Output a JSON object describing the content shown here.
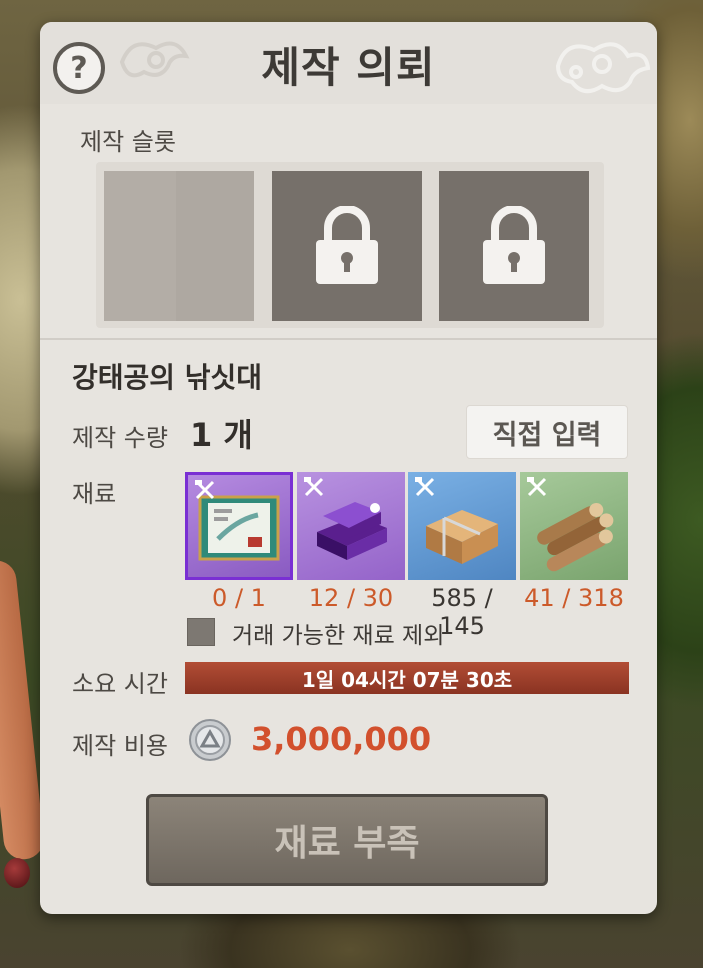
{
  "panel": {
    "title": "제작 의뢰",
    "help_icon_glyph": "?"
  },
  "slots": {
    "label": "제작 슬롯",
    "items": [
      {
        "state": "open"
      },
      {
        "state": "locked",
        "icon": "lock-icon"
      },
      {
        "state": "locked",
        "icon": "lock-icon"
      }
    ]
  },
  "item": {
    "name": "강태공의 낚싯대"
  },
  "quantity": {
    "label": "제작 수량",
    "value": "1 개",
    "input_button_label": "직접 입력"
  },
  "materials": {
    "label": "재료",
    "items": [
      {
        "icon": "blueprint-scroll-icon",
        "count": "0 / 1",
        "sufficient": false,
        "frame_color": "#7a2fd3"
      },
      {
        "icon": "purple-crystal-ingot-icon",
        "count": "12 / 30",
        "sufficient": false
      },
      {
        "icon": "timber-bundle-icon",
        "count": "585 / 145",
        "sufficient": true
      },
      {
        "icon": "log-bundle-icon",
        "count": "41 / 318",
        "sufficient": false
      }
    ],
    "exclude_tradeable_label": "거래 가능한 재료 제외",
    "exclude_tradeable_checked": false
  },
  "time": {
    "label": "소요 시간",
    "value": "1일 04시간 07분 30초"
  },
  "cost": {
    "label": "제작 비용",
    "icon": "silver-coin-icon",
    "value": "3,000,000"
  },
  "craft_button": {
    "label": "재료 부족"
  },
  "colors": {
    "shortage_red": "#cc5a2a",
    "cost_red": "#d2502d",
    "time_bar": "#9e3f2b"
  }
}
